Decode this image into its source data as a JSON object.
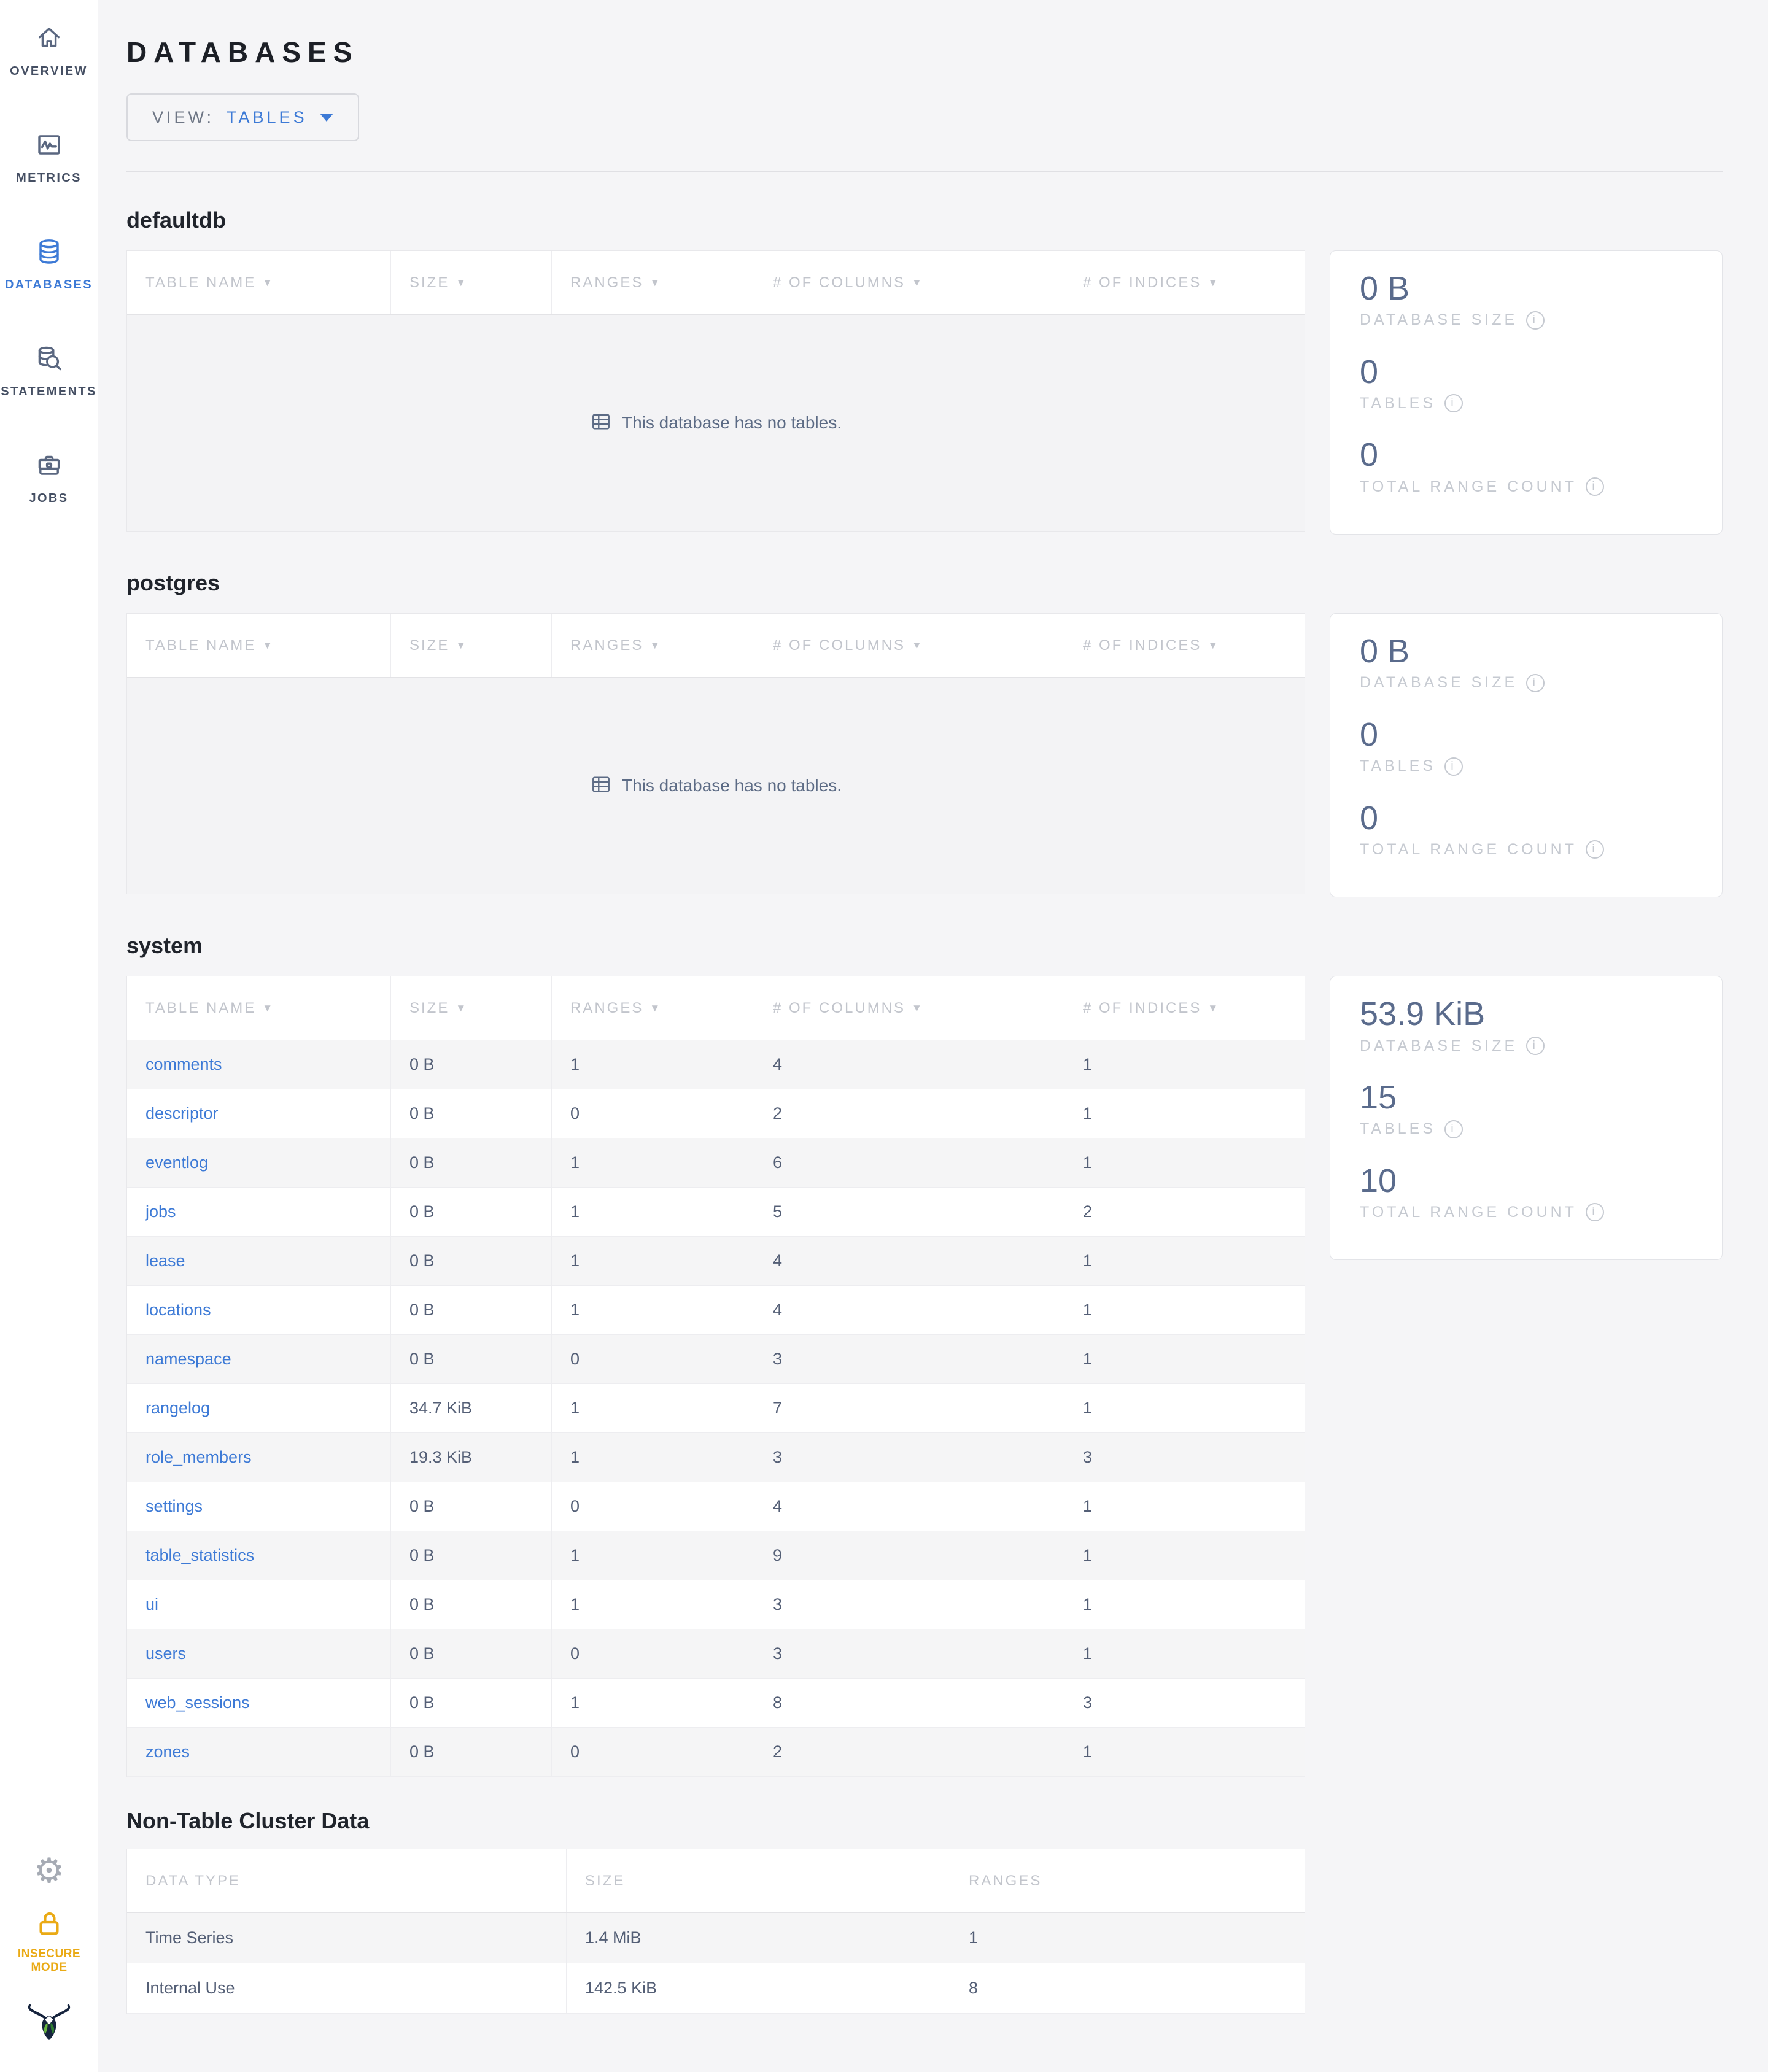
{
  "colors": {
    "accent_blue": "#3d7ad6",
    "link_blue": "#3d7ad6",
    "stat_slate": "#5a6b8c",
    "warning_gold": "#eaaa15",
    "page_background": "#f5f5f7"
  },
  "sidebar": {
    "items": [
      {
        "label": "OVERVIEW"
      },
      {
        "label": "METRICS"
      },
      {
        "label": "DATABASES"
      },
      {
        "label": "STATEMENTS"
      },
      {
        "label": "JOBS"
      }
    ],
    "insecure_label": "INSECURE MODE"
  },
  "header": {
    "title": "DATABASES",
    "view_label": "VIEW:",
    "view_value": "TABLES"
  },
  "table_headers": [
    "TABLE NAME",
    "SIZE",
    "RANGES",
    "# OF COLUMNS",
    "# OF INDICES"
  ],
  "stats_labels": {
    "size": "DATABASE SIZE",
    "tables": "TABLES",
    "ranges": "TOTAL RANGE COUNT"
  },
  "sections": [
    {
      "name": "defaultdb",
      "empty_message": "This database has no tables.",
      "stats": {
        "size": "0 B",
        "tables": "0",
        "ranges": "0"
      }
    },
    {
      "name": "postgres",
      "empty_message": "This database has no tables.",
      "stats": {
        "size": "0 B",
        "tables": "0",
        "ranges": "0"
      }
    },
    {
      "name": "system",
      "stats": {
        "size": "53.9 KiB",
        "tables": "15",
        "ranges": "10"
      },
      "rows": [
        {
          "name": "comments",
          "size": "0 B",
          "ranges": "1",
          "columns": "4",
          "indices": "1"
        },
        {
          "name": "descriptor",
          "size": "0 B",
          "ranges": "0",
          "columns": "2",
          "indices": "1"
        },
        {
          "name": "eventlog",
          "size": "0 B",
          "ranges": "1",
          "columns": "6",
          "indices": "1"
        },
        {
          "name": "jobs",
          "size": "0 B",
          "ranges": "1",
          "columns": "5",
          "indices": "2"
        },
        {
          "name": "lease",
          "size": "0 B",
          "ranges": "1",
          "columns": "4",
          "indices": "1"
        },
        {
          "name": "locations",
          "size": "0 B",
          "ranges": "1",
          "columns": "4",
          "indices": "1"
        },
        {
          "name": "namespace",
          "size": "0 B",
          "ranges": "0",
          "columns": "3",
          "indices": "1"
        },
        {
          "name": "rangelog",
          "size": "34.7 KiB",
          "ranges": "1",
          "columns": "7",
          "indices": "1"
        },
        {
          "name": "role_members",
          "size": "19.3 KiB",
          "ranges": "1",
          "columns": "3",
          "indices": "3"
        },
        {
          "name": "settings",
          "size": "0 B",
          "ranges": "0",
          "columns": "4",
          "indices": "1"
        },
        {
          "name": "table_statistics",
          "size": "0 B",
          "ranges": "1",
          "columns": "9",
          "indices": "1"
        },
        {
          "name": "ui",
          "size": "0 B",
          "ranges": "1",
          "columns": "3",
          "indices": "1"
        },
        {
          "name": "users",
          "size": "0 B",
          "ranges": "0",
          "columns": "3",
          "indices": "1"
        },
        {
          "name": "web_sessions",
          "size": "0 B",
          "ranges": "1",
          "columns": "8",
          "indices": "3"
        },
        {
          "name": "zones",
          "size": "0 B",
          "ranges": "0",
          "columns": "2",
          "indices": "1"
        }
      ]
    }
  ],
  "non_table": {
    "title": "Non-Table Cluster Data",
    "headers": [
      "DATA TYPE",
      "SIZE",
      "RANGES"
    ],
    "rows": [
      {
        "type": "Time Series",
        "size": "1.4 MiB",
        "ranges": "1"
      },
      {
        "type": "Internal Use",
        "size": "142.5 KiB",
        "ranges": "8"
      }
    ]
  }
}
